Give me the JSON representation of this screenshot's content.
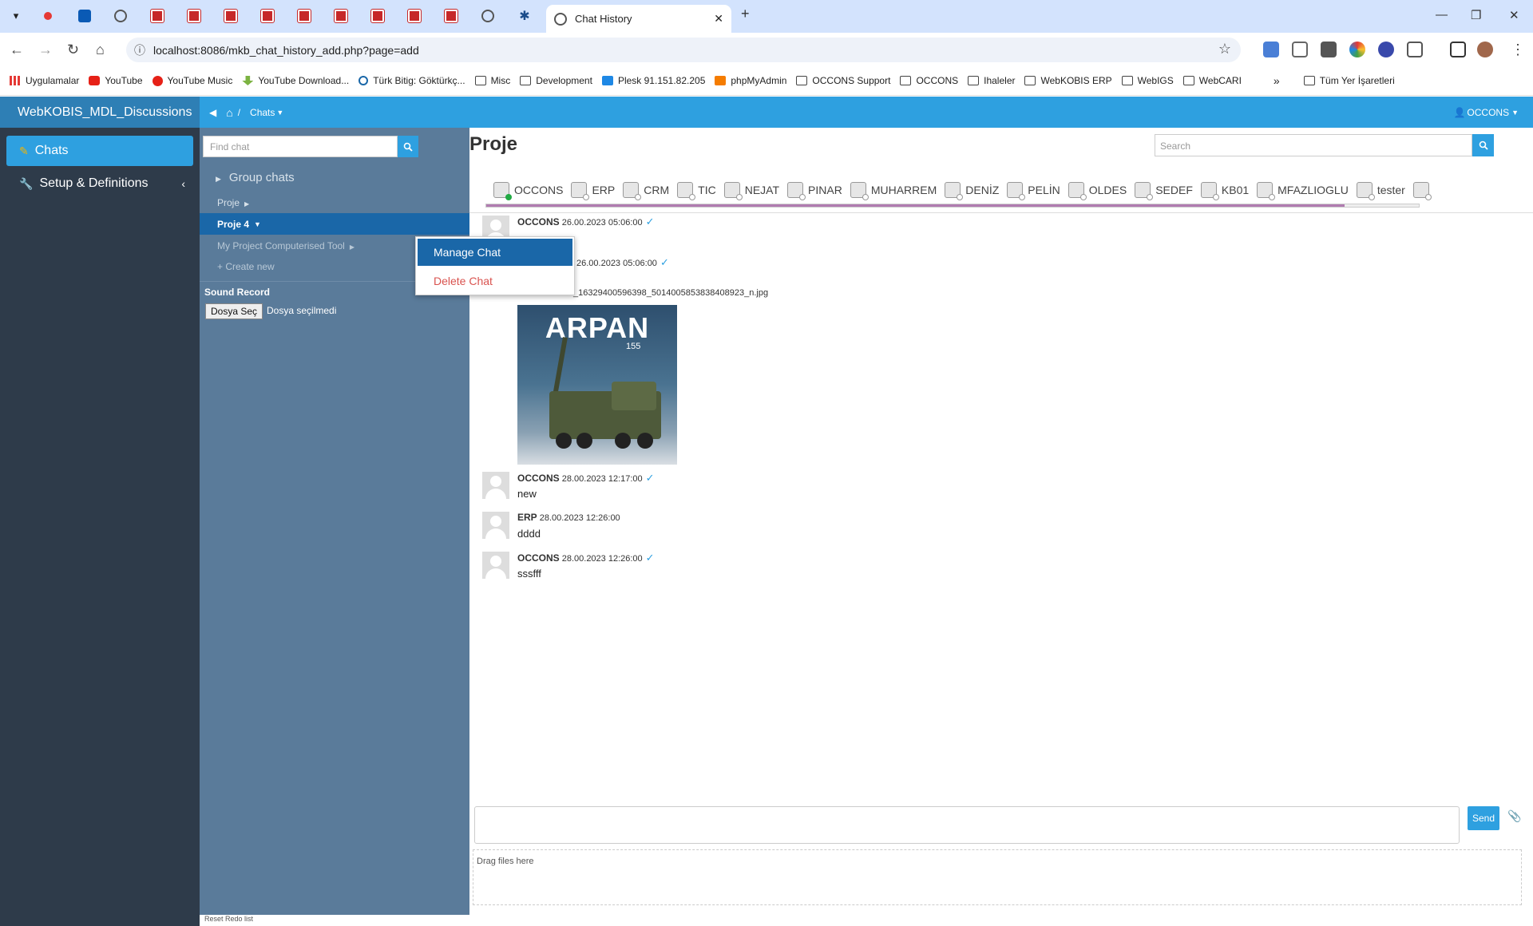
{
  "browser": {
    "tab_title": "Chat History",
    "url": "localhost:8086/mkb_chat_history_add.php?page=add",
    "new_tab": "+",
    "bookmarks": [
      {
        "label": "Uygulamalar",
        "icon": "apps-icon"
      },
      {
        "label": "YouTube",
        "icon": "youtube-icon"
      },
      {
        "label": "YouTube Music",
        "icon": "youtube-music-icon"
      },
      {
        "label": "YouTube Download...",
        "icon": "download-icon"
      },
      {
        "label": "Türk Bitig: Göktürkç...",
        "icon": "bitig-icon"
      },
      {
        "label": "Misc",
        "icon": "folder-icon"
      },
      {
        "label": "Development",
        "icon": "folder-icon"
      },
      {
        "label": "Plesk 91.151.82.205",
        "icon": "plesk-icon"
      },
      {
        "label": "phpMyAdmin",
        "icon": "phpmyadmin-icon"
      },
      {
        "label": "OCCONS Support",
        "icon": "folder-icon"
      },
      {
        "label": "OCCONS",
        "icon": "folder-icon"
      },
      {
        "label": "Ihaleler",
        "icon": "folder-icon"
      },
      {
        "label": "WebKOBIS ERP",
        "icon": "folder-icon"
      },
      {
        "label": "WebIGS",
        "icon": "folder-icon"
      },
      {
        "label": "WebCARI",
        "icon": "folder-icon"
      }
    ],
    "more_bookmarks": "»",
    "all_bookmarks": "Tüm Yer İşaretleri"
  },
  "app": {
    "brand": "WebKOBIS_MDL_Discussions",
    "breadcrumb": {
      "separator": "/",
      "current": "Chats"
    },
    "user": "OCCONS"
  },
  "sidebar": {
    "items": [
      {
        "label": "Chats",
        "active": true
      },
      {
        "label": "Setup & Definitions",
        "active": false
      }
    ]
  },
  "chat_list": {
    "find_placeholder": "Find chat",
    "group_chats": "Group chats",
    "items": [
      "Proje",
      "Proje 4",
      "My Project Computerised Tool"
    ],
    "create_new": "+ Create new",
    "sound_record": "Sound Record",
    "file_button": "Dosya Seç",
    "file_status": "Dosya seçilmedi",
    "bottom_text": "Reset   Redo list"
  },
  "context_menu": {
    "manage": "Manage Chat",
    "delete": "Delete Chat"
  },
  "chat": {
    "title": "Proje",
    "search_placeholder": "Search",
    "members": [
      {
        "name": "OCCONS",
        "online": true
      },
      {
        "name": "ERP",
        "online": false
      },
      {
        "name": "CRM",
        "online": false
      },
      {
        "name": "TIC",
        "online": false
      },
      {
        "name": "NEJAT",
        "online": false
      },
      {
        "name": "PINAR",
        "online": false
      },
      {
        "name": "MUHARREM",
        "online": false
      },
      {
        "name": "DENİZ",
        "online": false
      },
      {
        "name": "PELİN",
        "online": false
      },
      {
        "name": "OLDES",
        "online": false
      },
      {
        "name": "SEDEF",
        "online": false
      },
      {
        "name": "KB01",
        "online": false
      },
      {
        "name": "MFAZLIOGLU",
        "online": false
      },
      {
        "name": "tester",
        "online": false
      },
      {
        "name": "",
        "online": false
      }
    ],
    "progress": 0.92,
    "messages": [
      {
        "user": "OCCONS",
        "time": "26.00.2023 05:06:00",
        "text": ""
      },
      {
        "user": "",
        "time": "26.00.2023 05:06:00",
        "text": ""
      },
      {
        "user": "OCCONS",
        "time": "28.00.2023 12:17:00",
        "text": "new"
      },
      {
        "user": "ERP",
        "time": "28.00.2023 12:26:00",
        "text": "dddd"
      },
      {
        "user": "OCCONS",
        "time": "28.00.2023 12:26:00",
        "text": "sssfff"
      }
    ],
    "attachment_name": "_16329400596398_5014005853838408923_n.jpg",
    "poster_title": "ARPAN",
    "poster_number": "155",
    "send": "Send",
    "drop_text": "Drag files here"
  }
}
